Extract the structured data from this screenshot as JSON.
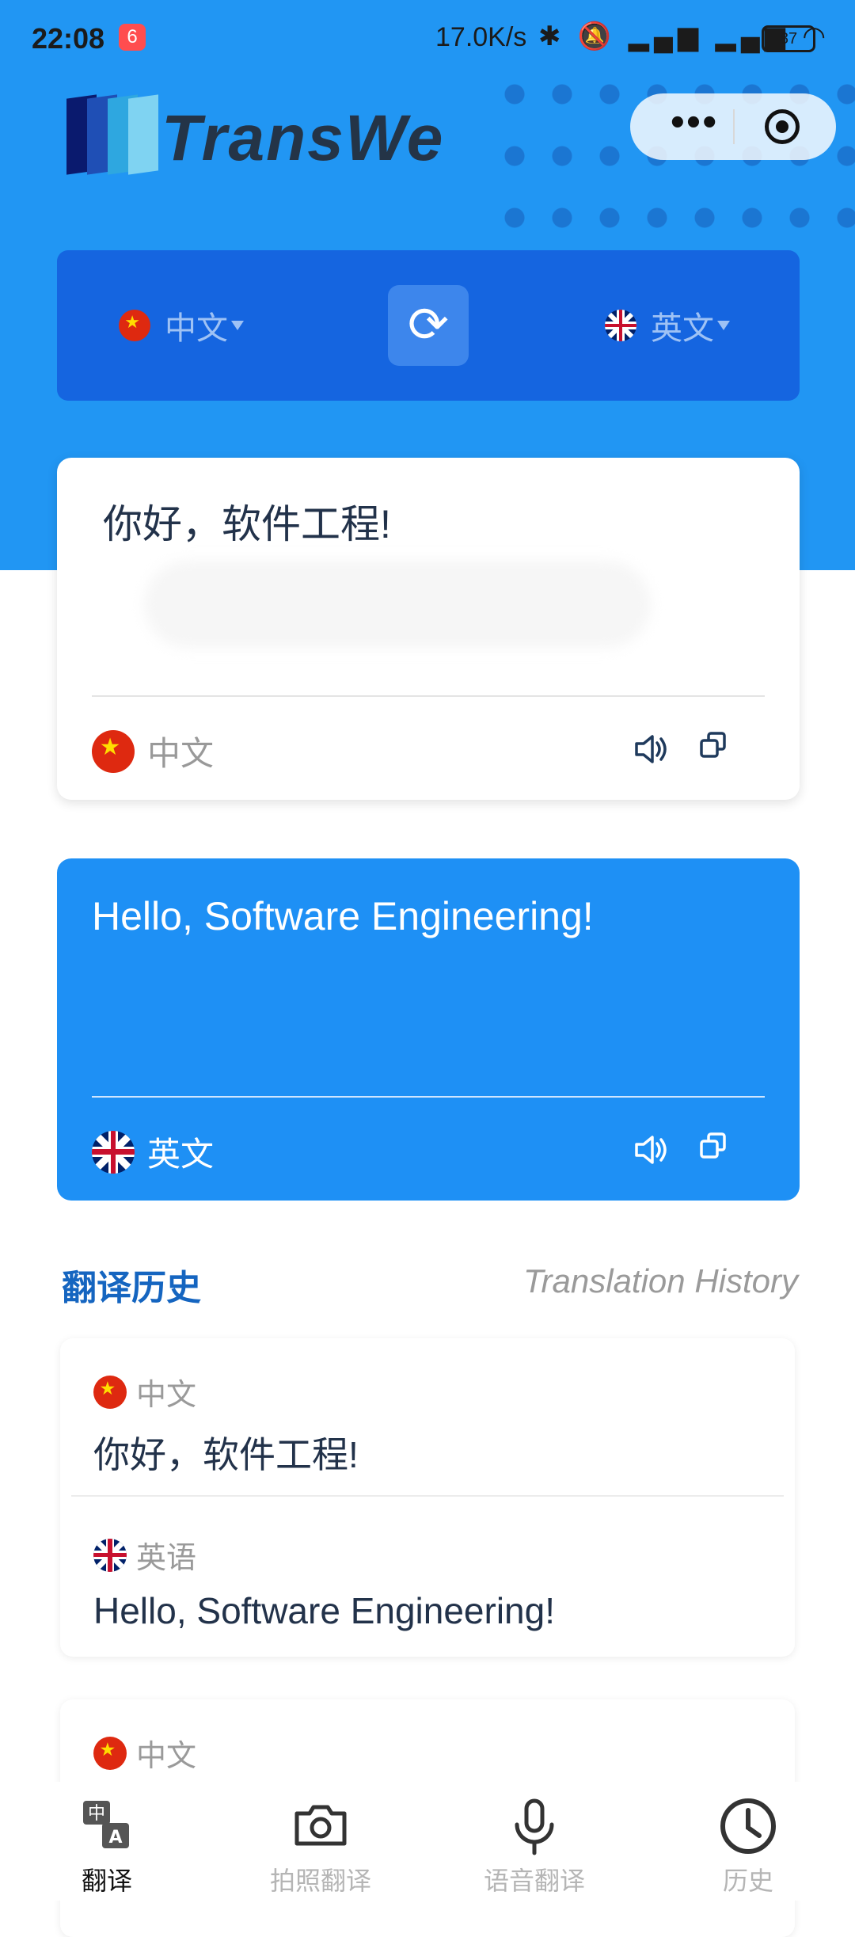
{
  "status_bar": {
    "time": "22:08",
    "notification_badge": "6",
    "network_speed": "17.0K/s",
    "battery": "87"
  },
  "app": {
    "brand": "TransWe"
  },
  "language_bar": {
    "source_lang": "中文",
    "target_lang": "英文"
  },
  "source_card": {
    "text": "你好，软件工程!",
    "lang": "中文"
  },
  "target_card": {
    "text": "Hello, Software Engineering!",
    "lang": "英文"
  },
  "history": {
    "title": "翻译历史",
    "subtitle": "Translation History",
    "items": [
      {
        "source_lang": "中文",
        "source_text": "你好，软件工程!",
        "target_lang": "英语",
        "target_text": "Hello, Software Engineering!"
      },
      {
        "source_lang": "中文"
      }
    ]
  },
  "tabbar": {
    "tabs": [
      {
        "label": "翻译",
        "icon": "translate-icon",
        "active": true
      },
      {
        "label": "拍照翻译",
        "icon": "camera-icon",
        "active": false
      },
      {
        "label": "语音翻译",
        "icon": "microphone-icon",
        "active": false
      },
      {
        "label": "历史",
        "icon": "clock-icon",
        "active": false
      }
    ]
  },
  "colors": {
    "primary": "#2196f3",
    "lang_bar": "#1565e0",
    "target_card": "#1e90f5",
    "history_title": "#1565c0"
  }
}
